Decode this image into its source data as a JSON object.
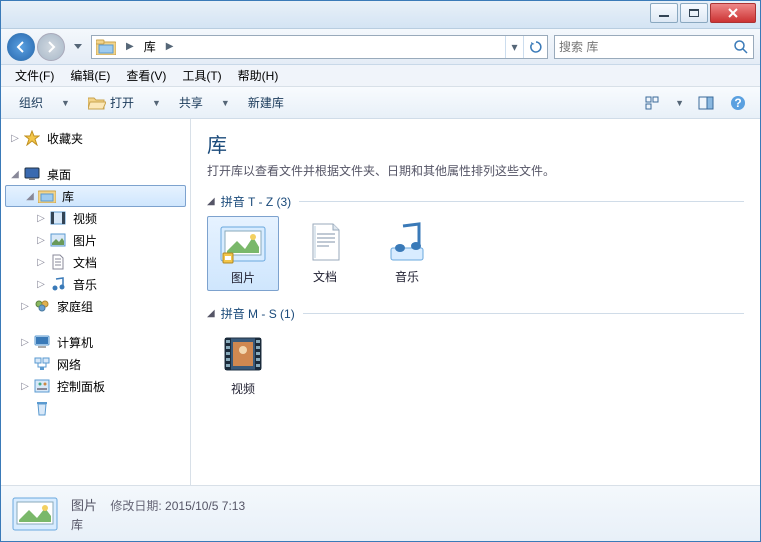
{
  "titlebar": {},
  "nav": {
    "breadcrumb": "库",
    "search_placeholder": "搜索 库"
  },
  "menu": {
    "file": "文件(F)",
    "edit": "编辑(E)",
    "view": "查看(V)",
    "tools": "工具(T)",
    "help": "帮助(H)"
  },
  "toolbar": {
    "organize": "组织",
    "open": "打开",
    "share": "共享",
    "new_lib": "新建库"
  },
  "tree": {
    "favorites": "收藏夹",
    "desktop": "桌面",
    "libraries": "库",
    "videos": "视频",
    "pictures": "图片",
    "documents": "文档",
    "music": "音乐",
    "homegroup": "家庭组",
    "computer": "计算机",
    "network": "网络",
    "control": "控制面板",
    "recycle": "回收站"
  },
  "content": {
    "title": "库",
    "subtitle": "打开库以查看文件并根据文件夹、日期和其他属性排列这些文件。",
    "group1_label": "拼音 T - Z (3)",
    "group2_label": "拼音 M - S (1)",
    "items1": {
      "pictures": "图片",
      "documents": "文档",
      "music": "音乐"
    },
    "items2": {
      "videos": "视频"
    }
  },
  "details": {
    "name": "图片",
    "mod_key": "修改日期:",
    "mod_val": "2015/10/5 7:13",
    "type": "库"
  }
}
